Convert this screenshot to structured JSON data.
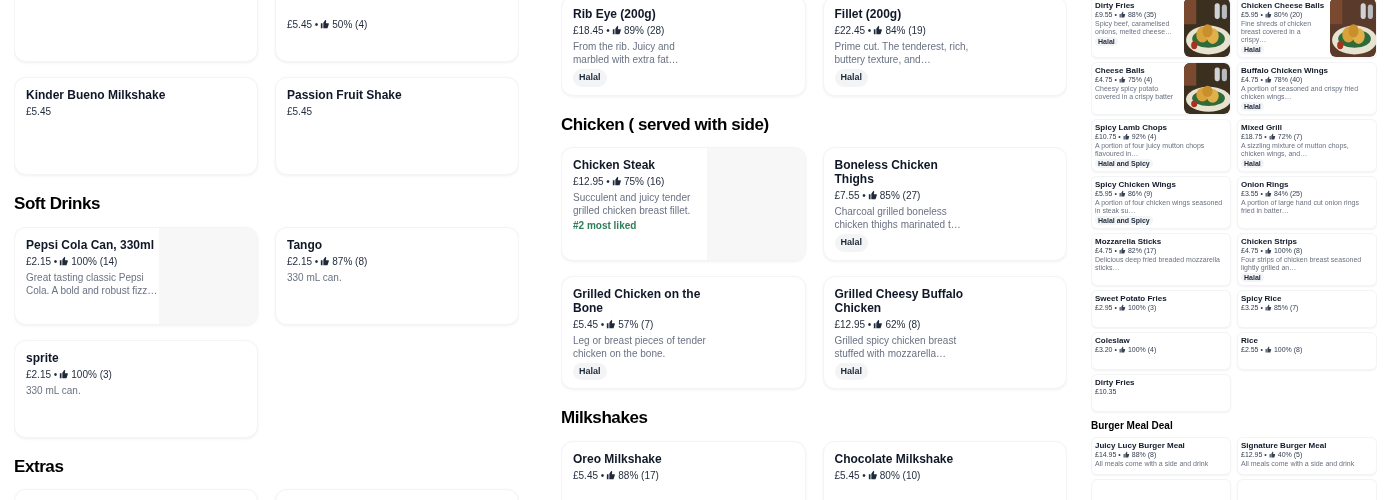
{
  "panels": [
    {
      "sections": [
        {
          "items": [
            {
              "kind": "blank"
            },
            {
              "price": "£5.45 •",
              "rating": "50% (4)"
            },
            {
              "name": "Kinder Bueno Milkshake",
              "price": "£5.45"
            },
            {
              "name": "Passion Fruit Shake",
              "price": "£5.45"
            }
          ]
        },
        {
          "heading": "Soft Drinks",
          "items": [
            {
              "name": "Pepsi Cola Can, 330ml",
              "price": "£2.15 •",
              "rating": "100% (14)",
              "description": "Great tasting classic Pepsi Cola. A bold and robust fizz…",
              "kind": "placeholder"
            },
            {
              "name": "Tango",
              "price": "£2.15 •",
              "rating": "87% (8)",
              "description": "330 mL can."
            },
            {
              "name": "sprite",
              "price": "£2.15 •",
              "rating": "100% (3)",
              "description": "330 mL can."
            }
          ]
        },
        {
          "heading": "Extras",
          "items": [
            {
              "kind": "blank"
            },
            {
              "kind": "blank"
            }
          ]
        }
      ]
    },
    {
      "sections": [
        {
          "items": [
            {
              "name": "Rib Eye (200g)",
              "price": "£18.45 •",
              "rating": "89% (28)",
              "description": "From the rib. Juicy and marbled with extra fat…",
              "tag": "Halal"
            },
            {
              "name": "Fillet (200g)",
              "price": "£22.45 •",
              "rating": "84% (19)",
              "description": "Prime cut. The tenderest, rich, buttery texture, and…",
              "tag": "Halal"
            }
          ]
        },
        {
          "heading": "Chicken ( served with side)",
          "items": [
            {
              "name": "Chicken Steak",
              "price": "£12.95 •",
              "rating": "75% (16)",
              "description": "Succulent and juicy tender grilled chicken breast fillet.",
              "highlight": "#2 most liked",
              "kind": "placeholder"
            },
            {
              "name": "Boneless Chicken Thighs",
              "price": "£7.55 •",
              "rating": "85% (27)",
              "description": "Charcoal grilled boneless chicken thighs marinated t…",
              "tag": "Halal"
            },
            {
              "name": "Grilled Chicken on the Bone",
              "price": "£5.45 •",
              "rating": "57% (7)",
              "description": "Leg or breast pieces of tender chicken on the bone.",
              "tag": "Halal"
            },
            {
              "name": "Grilled Cheesy Buffalo Chicken",
              "price": "£12.95 •",
              "rating": "62% (8)",
              "description": "Grilled spicy chicken breast stuffed with mozzarella…",
              "tag": "Halal"
            }
          ]
        },
        {
          "heading": "Milkshakes",
          "items": [
            {
              "name": "Oreo Milkshake",
              "price": "£5.45 •",
              "rating": "88% (17)"
            },
            {
              "name": "Chocolate Milkshake",
              "price": "£5.45 •",
              "rating": "80% (10)"
            }
          ]
        }
      ]
    },
    {
      "sections": [
        {
          "items": [
            {
              "name": "Dirty Fries",
              "price": "£9.55 •",
              "rating": "88% (35)",
              "description": "Spicy beef, caramelised onions, melted cheese…",
              "tag": "Halal"
            },
            {
              "name": "Chicken Cheese Balls",
              "price": "£5.95 •",
              "rating": "80% (20)",
              "description": "Fine shreds of chicken breast covered in a crispy…",
              "tag": "Halal"
            },
            {
              "name": "Cheese Balls",
              "price": "£4.75 •",
              "rating": "75% (4)",
              "description": "Cheesy spicy potato covered in a crispy batter"
            },
            {
              "name": "Buffalo Chicken Wings",
              "price": "£4.75 •",
              "rating": "78% (40)",
              "description": "A portion of seasoned and crispy fried chicken wings…",
              "tag": "Halal"
            },
            {
              "name": "Spicy Lamb Chops",
              "price": "£10.75 •",
              "rating": "92% (4)",
              "description": "A portion of four juicy mutton chops flavoured in…",
              "tag": "Halal and Spicy"
            },
            {
              "name": "Mixed Grill",
              "price": "£18.75 •",
              "rating": "72% (7)",
              "description": "A sizzling mixture of mutton chops, chicken wings, and…",
              "tag": "Halal"
            },
            {
              "name": "Spicy Chicken Wings",
              "price": "£5.95 •",
              "rating": "86% (9)",
              "description": "A portion of four chicken wings seasoned in steak su…",
              "tag": "Halal and Spicy"
            },
            {
              "name": "Onion Rings",
              "price": "£3.55 •",
              "rating": "84% (25)",
              "description": "A portion of large hand cut onion rings fried in batter…"
            },
            {
              "name": "Mozzarella Sticks",
              "price": "£4.75 •",
              "rating": "82% (17)",
              "description": "Delicious deep fried breaded mozzarella sticks…"
            },
            {
              "name": "Chicken Strips",
              "price": "£4.75 •",
              "rating": "100% (8)",
              "description": "Four strips of chicken breast seasoned lightly grilled an…",
              "tag": "Halal"
            },
            {
              "name": "Sweet Potato Fries",
              "price": "£2.95 •",
              "rating": "100% (3)"
            },
            {
              "name": "Spicy Rice",
              "price": "£3.25 •",
              "rating": "85% (7)"
            },
            {
              "name": "Coleslaw",
              "price": "£3.20 •",
              "rating": "100% (4)"
            },
            {
              "name": "Rice",
              "price": "£2.55 •",
              "rating": "100% (8)"
            },
            {
              "name": "Dirty Fries",
              "price": "£10.35"
            }
          ]
        },
        {
          "heading": "Burger Meal Deal",
          "items": [
            {
              "name": "Juicy Lucy Burger Meal",
              "price": "£14.95 •",
              "rating": "88% (8)",
              "description": "All meals come with a side and drink"
            },
            {
              "name": "Signature Burger Meal",
              "price": "£12.95 •",
              "rating": "40% (5)",
              "description": "All meals come with a side and drink"
            },
            {
              "kind": "blank"
            },
            {
              "kind": "blank"
            }
          ]
        }
      ]
    }
  ]
}
